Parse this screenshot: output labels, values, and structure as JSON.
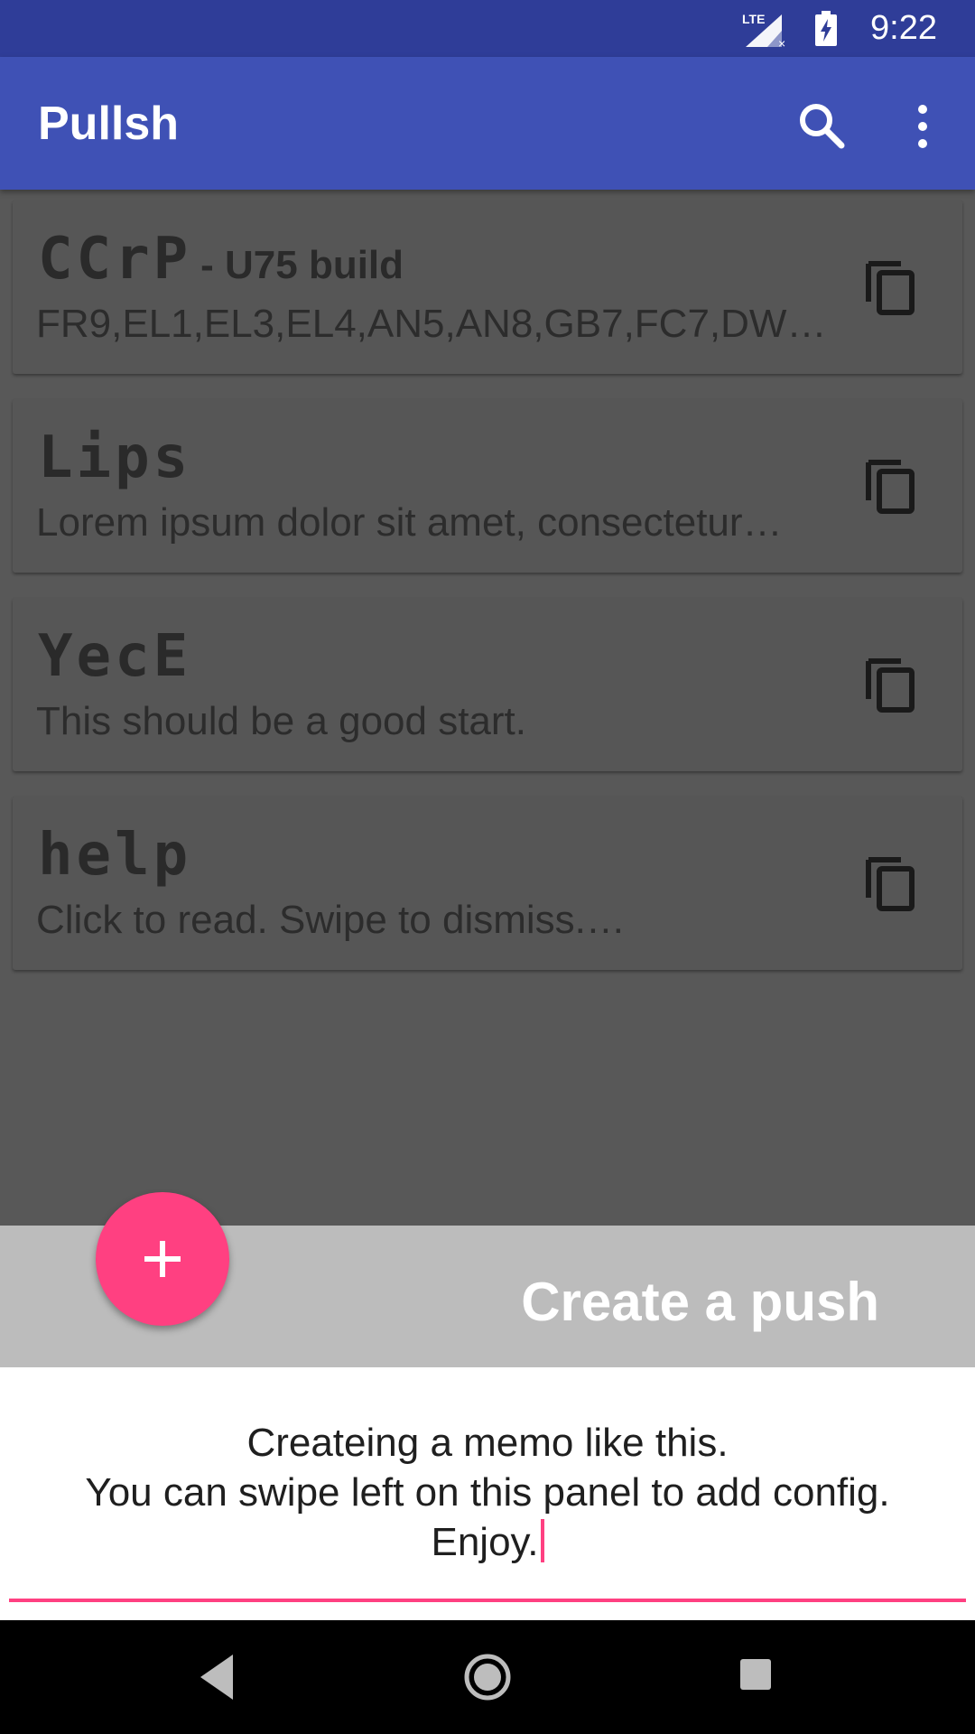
{
  "status_bar": {
    "time": "9:22",
    "network": "LTE",
    "icons": [
      "lte-signal-icon",
      "battery-charging-icon"
    ]
  },
  "app_bar": {
    "title": "Pullsh",
    "actions": [
      "search-icon",
      "more-vert-icon"
    ]
  },
  "cards": [
    {
      "title": "CCrP",
      "subtitle": "- U75 build",
      "text": "FR9,EL1,EL3,EL4,AN5,AN8,GB7,FC7,DW2,…",
      "icon": "copy-icon"
    },
    {
      "title": "Lips",
      "subtitle": "",
      "text": "Lorem ipsum dolor sit amet, consectetur…",
      "icon": "copy-icon"
    },
    {
      "title": "YecE",
      "subtitle": "",
      "text": "This should be a good start.",
      "icon": "copy-icon"
    },
    {
      "title": "help",
      "subtitle": "",
      "text": "Click to read. Swipe to dismiss.…",
      "icon": "copy-icon"
    }
  ],
  "create_panel": {
    "title": "Create a push",
    "fab_icon": "add-icon",
    "memo_lines": [
      "Createing a memo like this.",
      "You can swipe left on this panel to add config.",
      "Enjoy."
    ]
  },
  "nav_bar": {
    "icons": [
      "back-icon",
      "home-icon",
      "recents-icon"
    ]
  },
  "colors": {
    "primary": "#3f51b5",
    "primary_dark": "#2f3d98",
    "accent": "#ff4081",
    "scrim": "#585858"
  }
}
